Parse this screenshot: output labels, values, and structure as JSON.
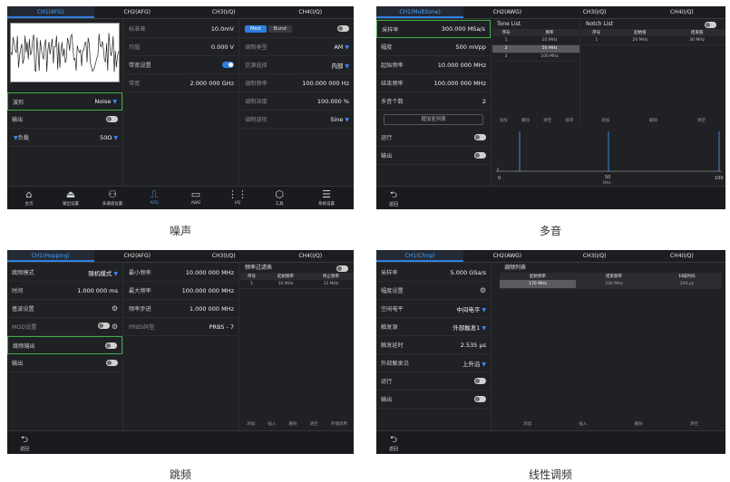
{
  "tabs_common": [
    "CH2(AFG)",
    "CH3(I/Q)",
    "CH4(I/Q)"
  ],
  "p1": {
    "tab_active": "CH1(AFG)",
    "left": [
      {
        "l": "波形",
        "v": "Noise"
      },
      {
        "l": "输出",
        "v": ""
      },
      {
        "l": "负载",
        "v": "50Ω"
      }
    ],
    "mid": [
      {
        "l": "标准差",
        "v": "10.0mV"
      },
      {
        "l": "均值",
        "v": "0.000 V"
      },
      {
        "l": "带宽设置",
        "v": ""
      },
      {
        "l": "带宽",
        "v": "2.000 000  GHz"
      }
    ],
    "mod_btn": "Mod",
    "burst_btn": "Burst",
    "right": [
      {
        "l": "调制类型",
        "v": "AM"
      },
      {
        "l": "信源选择",
        "v": "内部"
      },
      {
        "l": "调制频率",
        "v": "100.000 000 Hz"
      },
      {
        "l": "调制深度",
        "v": "100.000 %"
      },
      {
        "l": "调制波形",
        "v": "Sine"
      }
    ],
    "nav": [
      "主页",
      "输出设置",
      "多通道设置",
      "AFG",
      "AWG",
      "I/Q",
      "工具",
      "系统设置"
    ]
  },
  "p2": {
    "tab_active": "CH1(Multitone)",
    "tab2": "CH2(AWG)",
    "rows": [
      {
        "l": "采样率",
        "v": "300.000 MSa/s"
      },
      {
        "l": "幅度",
        "v": "500 mVpp"
      },
      {
        "l": "起始频率",
        "v": "10.000 000  MHz"
      },
      {
        "l": "结束频率",
        "v": "100.000 000  MHz"
      },
      {
        "l": "多音个数",
        "v": "2"
      }
    ],
    "add_list": "增加至列表",
    "run": "运行",
    "out": "输出",
    "tone_title": "Tone List",
    "tone_head": [
      "序号",
      "频率"
    ],
    "tone_rows": [
      [
        "1",
        "10 MHz"
      ],
      [
        "2",
        "50 MHz"
      ],
      [
        "3",
        "100 MHz"
      ]
    ],
    "tone_foot": [
      "添加",
      "删除",
      "清空",
      "排序"
    ],
    "notch_title": "Notch List",
    "notch_head": [
      "序号",
      "起始值",
      "结束值"
    ],
    "notch_rows": [
      [
        "1",
        "20 MHz",
        "30 MHz"
      ]
    ],
    "notch_foot": [
      "添加",
      "删除",
      "清空"
    ],
    "axis": [
      "0",
      "50",
      "100"
    ],
    "axis_unit": "MHz",
    "back": "返回"
  },
  "p3": {
    "tab_active": "CH1(Hopping)",
    "left": [
      {
        "l": "跳频模式",
        "v": "随机模式"
      },
      {
        "l": "时间",
        "v": "1.000 000 ms"
      },
      {
        "l": "基波设置",
        "v": ""
      },
      {
        "l": "MOD设置",
        "v": ""
      },
      {
        "l": "跳频输出",
        "v": ""
      },
      {
        "l": "输出",
        "v": ""
      }
    ],
    "mid": [
      {
        "l": "最小频率",
        "v": "10.000 000  MHz"
      },
      {
        "l": "最大频率",
        "v": "100.000 000  MHz"
      },
      {
        "l": "频率步进",
        "v": "1.000 000  MHz"
      },
      {
        "l": "PRBS码型",
        "v": "PRBS - 7"
      }
    ],
    "list_title": "频率过滤表",
    "list_head": [
      "序号",
      "起始频率",
      "终止频率"
    ],
    "list_rows": [
      [
        "1",
        "10 MHz",
        "11 MHz"
      ]
    ],
    "list_foot": [
      "添加",
      "插入",
      "删除",
      "清空",
      "存储调用"
    ],
    "back": "返回"
  },
  "p4": {
    "tab_active": "CH1(Chirp)",
    "tab2": "CH2(AWG)",
    "rows": [
      {
        "l": "采样率",
        "v": "5.000 GSa/s"
      },
      {
        "l": "幅度设置",
        "v": ""
      },
      {
        "l": "空闲电平",
        "v": "中间电平"
      },
      {
        "l": "触发源",
        "v": "外部触发1"
      },
      {
        "l": "触发延时",
        "v": "2.535 µs"
      },
      {
        "l": "外部触发沿",
        "v": "上升沿"
      },
      {
        "l": "运行",
        "v": ""
      },
      {
        "l": "输出",
        "v": ""
      }
    ],
    "list_title": "调频列表",
    "list_head": [
      "起始频率",
      "结束频率",
      "扫描时间"
    ],
    "list_rows": [
      [
        "170 MHz",
        "230 MHz",
        "200 µs"
      ]
    ],
    "list_foot": [
      "添加",
      "插入",
      "删除",
      "清空"
    ],
    "back": "返回"
  },
  "captions": [
    "噪声",
    "多音",
    "跳频",
    "线性调频"
  ]
}
